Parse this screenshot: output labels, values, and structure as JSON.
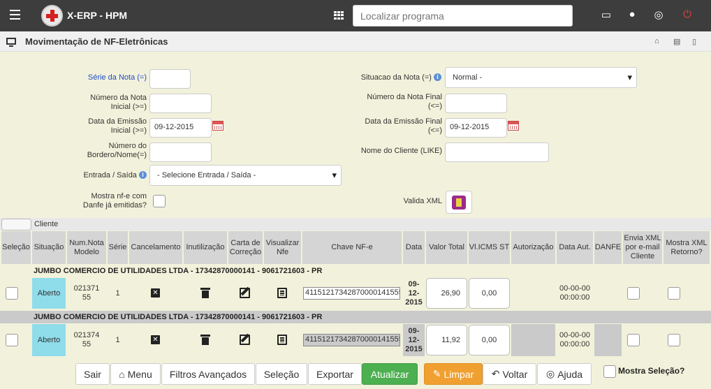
{
  "app": {
    "title": "X-ERP - HPM"
  },
  "search": {
    "placeholder": "Localizar programa"
  },
  "page": {
    "title": "Movimentação de NF-Eletrônicas"
  },
  "form": {
    "serie_label": "Série da Nota (=)",
    "numero_inicial_label_1": "Número da Nota",
    "numero_inicial_label_2": "Inicial (>=)",
    "data_emissao_inicial_label_1": "Data da Emissão",
    "data_emissao_inicial_label_2": "Inicial (>=)",
    "data_emissao_inicial_value": "09-12-2015",
    "bordero_label_1": "Número do",
    "bordero_label_2": "Bordero/Nome(=)",
    "entrada_saida_label": "Entrada / Saída",
    "entrada_saida_value": "- Selecione Entrada / Saída -",
    "mostra_nfe_label_1": "Mostra nf-e com",
    "mostra_nfe_label_2": "Danfe já emitidas?",
    "situacao_label": "Situacao da Nota (=)",
    "situacao_value": "Normal -",
    "numero_final_label_1": "Número da Nota Final",
    "numero_final_label_2": "(<=)",
    "data_emissao_final_label_1": "Data da Emissão Final",
    "data_emissao_final_label_2": "(<=)",
    "data_emissao_final_value": "09-12-2015",
    "nome_cliente_label": "Nome do Cliente (LIKE)",
    "valida_xml_label": "Valida XML"
  },
  "table": {
    "group_label": "Cliente",
    "headers": [
      "Seleção",
      "Situação",
      "Num.Nota Modelo",
      "Série",
      "Cancelamento",
      "Inutilização",
      "Carta de Correção",
      "Visualizar Nfe",
      "Chave NF-e",
      "Data",
      "Valor Total",
      "Vl.ICMS ST",
      "Autorização",
      "Data Aut.",
      "DANFE",
      "Envia XML por e-mail Cliente",
      "Mostra XML Retorno?"
    ],
    "rows": [
      {
        "client": "JUMBO COMERCIO DE UTILIDADES LTDA - 17342870000141 - 9061721603 - PR",
        "situacao": "Aberto",
        "num_nota_1": "021371",
        "num_nota_2": "55",
        "serie": "1",
        "chave": "41151217342870000141555",
        "data_1": "09-",
        "data_2": "12-",
        "data_3": "2015",
        "valor_total": "26,90",
        "icms_st": "0,00",
        "data_aut_1": "00-00-00",
        "data_aut_2": "00:00:00"
      },
      {
        "client": "JUMBO COMERCIO DE UTILIDADES LTDA - 17342870000141 - 9061721603 - PR",
        "situacao": "Aberto",
        "num_nota_1": "021374",
        "num_nota_2": "55",
        "serie": "1",
        "chave": "41151217342870000141555",
        "data_1": "09-",
        "data_2": "12-",
        "data_3": "2015",
        "valor_total": "11,92",
        "icms_st": "0,00",
        "data_aut_1": "00-00-00",
        "data_aut_2": "00:00:00"
      }
    ]
  },
  "buttons": {
    "sair": "Sair",
    "menu": "Menu",
    "filtros": "Filtros Avançados",
    "selecao": "Seleção",
    "exportar": "Exportar",
    "atualizar": "Atualizar",
    "limpar": "Limpar",
    "voltar": "Voltar",
    "ajuda": "Ajuda",
    "mostra_selecao": "Mostra Seleção?"
  }
}
